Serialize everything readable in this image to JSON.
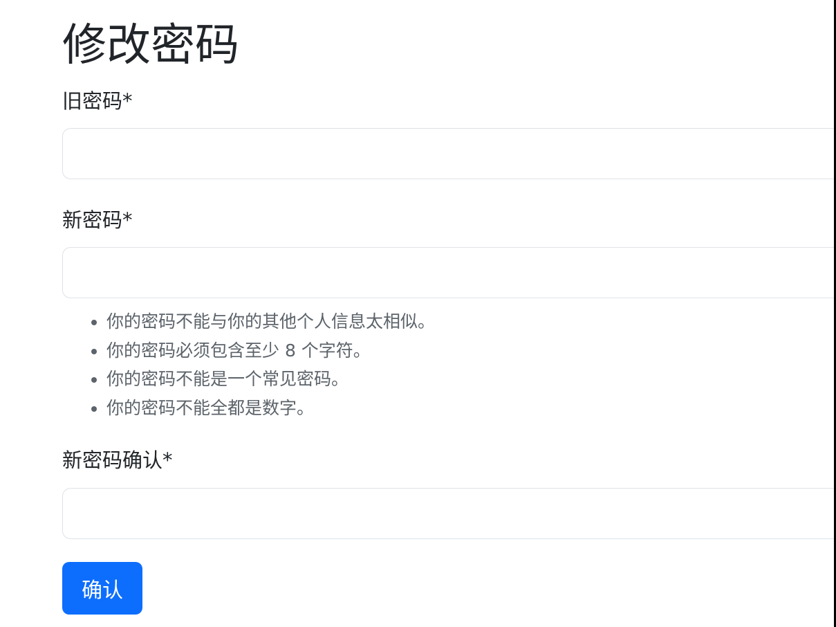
{
  "page_title": "修改密码",
  "fields": [
    {
      "label": "旧密码*",
      "value": ""
    },
    {
      "label": "新密码*",
      "value": ""
    },
    {
      "label": "新密码确认*",
      "value": ""
    }
  ],
  "help_items": [
    "你的密码不能与你的其他个人信息太相似。",
    "你的密码必须包含至少 8 个字符。",
    "你的密码不能是一个常见密码。",
    "你的密码不能全都是数字。"
  ],
  "submit_label": "确认",
  "colors": {
    "primary": "#0d6efd"
  }
}
